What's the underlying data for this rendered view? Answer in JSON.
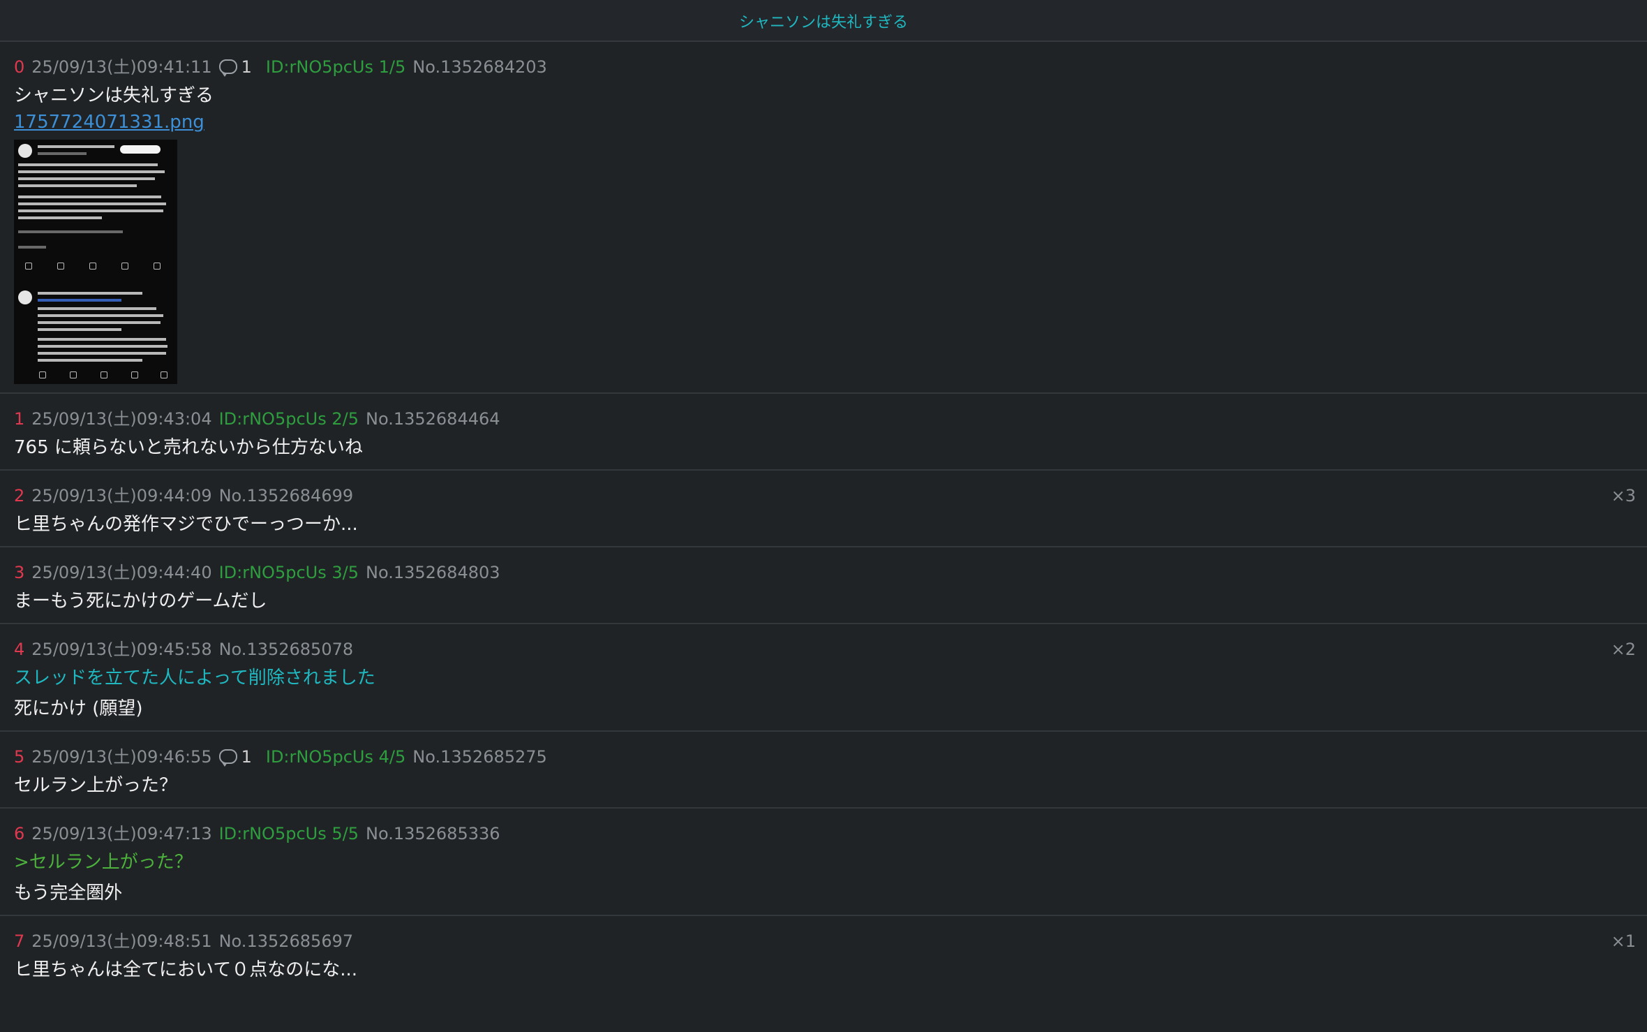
{
  "header": {
    "title": "シャニソンは失礼すぎる"
  },
  "posts": [
    {
      "num": "0",
      "date": "25/09/13(土)09:41:11",
      "replies": "1",
      "id": "ID:rNO5pcUs 1/5",
      "no": "No.1352684203",
      "lines": [
        "シャニソンは失礼すぎる"
      ],
      "file": "1757724071331.png"
    },
    {
      "num": "1",
      "date": "25/09/13(土)09:43:04",
      "id": "ID:rNO5pcUs 2/5",
      "no": "No.1352684464",
      "lines": [
        "765 に頼らないと売れないから仕方ないね"
      ]
    },
    {
      "num": "2",
      "date": "25/09/13(土)09:44:09",
      "no": "No.1352684699",
      "count": "×3",
      "lines": [
        "ヒ里ちゃんの発作マジでひでーっつーか..."
      ]
    },
    {
      "num": "3",
      "date": "25/09/13(土)09:44:40",
      "id": "ID:rNO5pcUs 3/5",
      "no": "No.1352684803",
      "lines": [
        "まーもう死にかけのゲームだし"
      ]
    },
    {
      "num": "4",
      "date": "25/09/13(土)09:45:58",
      "no": "No.1352685078",
      "count": "×2",
      "deleted": "スレッドを立てた人によって削除されました",
      "lines": [
        "死にかけ (願望)"
      ]
    },
    {
      "num": "5",
      "date": "25/09/13(土)09:46:55",
      "replies": "1",
      "id": "ID:rNO5pcUs 4/5",
      "no": "No.1352685275",
      "lines": [
        "セルラン上がった？"
      ]
    },
    {
      "num": "6",
      "date": "25/09/13(土)09:47:13",
      "id": "ID:rNO5pcUs 5/5",
      "no": "No.1352685336",
      "quote": ">セルラン上がった？",
      "lines": [
        "もう完全圏外"
      ]
    },
    {
      "num": "7",
      "date": "25/09/13(土)09:48:51",
      "no": "No.1352685697",
      "count": "×1",
      "lines": [
        "ヒ里ちゃんは全てにおいて０点なのにな..."
      ]
    }
  ]
}
